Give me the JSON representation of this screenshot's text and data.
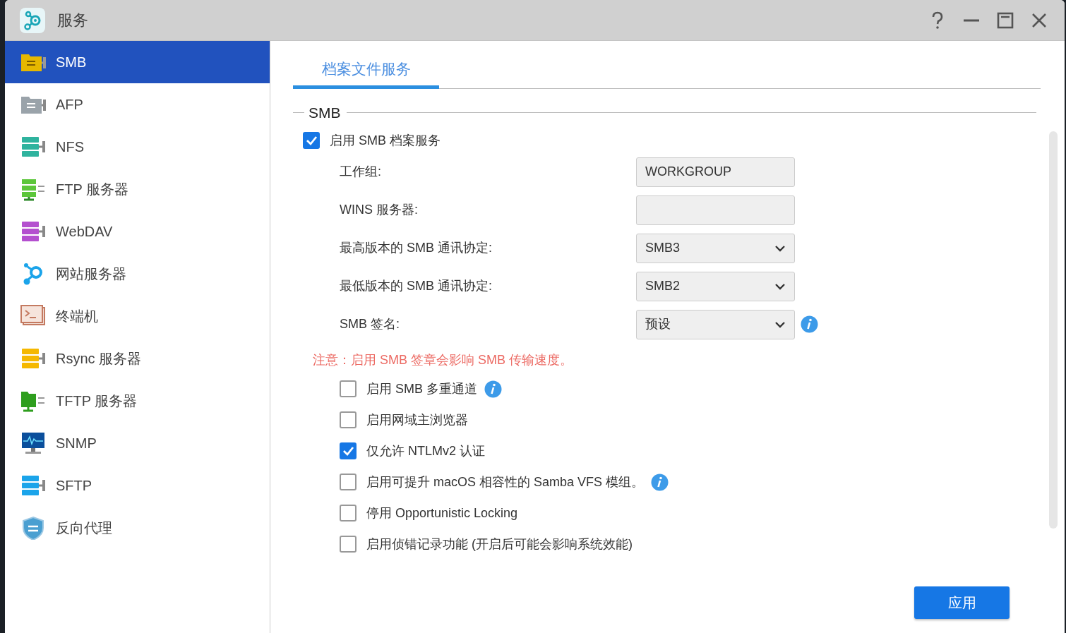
{
  "window": {
    "title": "服务"
  },
  "sidebar": {
    "items": [
      {
        "label": "SMB",
        "selected": true
      },
      {
        "label": "AFP",
        "selected": false
      },
      {
        "label": "NFS",
        "selected": false
      },
      {
        "label": "FTP 服务器",
        "selected": false
      },
      {
        "label": "WebDAV",
        "selected": false
      },
      {
        "label": "网站服务器",
        "selected": false
      },
      {
        "label": "终端机",
        "selected": false
      },
      {
        "label": "Rsync 服务器",
        "selected": false
      },
      {
        "label": "TFTP 服务器",
        "selected": false
      },
      {
        "label": "SNMP",
        "selected": false
      },
      {
        "label": "SFTP",
        "selected": false
      },
      {
        "label": "反向代理",
        "selected": false
      }
    ]
  },
  "tabs": [
    {
      "label": "档案文件服务",
      "selected": true
    }
  ],
  "section": {
    "legend": "SMB",
    "enable": {
      "label": "启用 SMB 档案服务",
      "checked": true
    },
    "fields": [
      {
        "kind": "text",
        "label": "工作组:",
        "value": "WORKGROUP",
        "info": false
      },
      {
        "kind": "text",
        "label": "WINS 服务器:",
        "info": false
      },
      {
        "kind": "select",
        "label": "最高版本的 SMB 通讯协定:",
        "value": "SMB3",
        "info": false
      },
      {
        "kind": "select",
        "label": "最低版本的 SMB 通讯协定:",
        "value": "SMB2",
        "info": false
      },
      {
        "kind": "select",
        "label": "SMB 签名:",
        "value": "预设",
        "info": true
      }
    ],
    "warning": "注意：启用 SMB 签章会影响 SMB 传输速度。",
    "options": [
      {
        "label": "启用 SMB 多重通道",
        "checked": false,
        "info": true
      },
      {
        "label": "启用网域主浏览器",
        "checked": false,
        "info": false
      },
      {
        "label": "仅允许 NTLMv2 认证",
        "checked": true,
        "info": false
      },
      {
        "label": "启用可提升 macOS 相容性的 Samba VFS 模组。",
        "checked": false,
        "info": true
      },
      {
        "label": "停用 Opportunistic Locking",
        "checked": false,
        "info": false
      },
      {
        "label": "启用侦错记录功能 (开启后可能会影响系统效能)",
        "checked": false,
        "info": false
      }
    ]
  },
  "buttons": [
    {
      "label": "应用"
    }
  ]
}
